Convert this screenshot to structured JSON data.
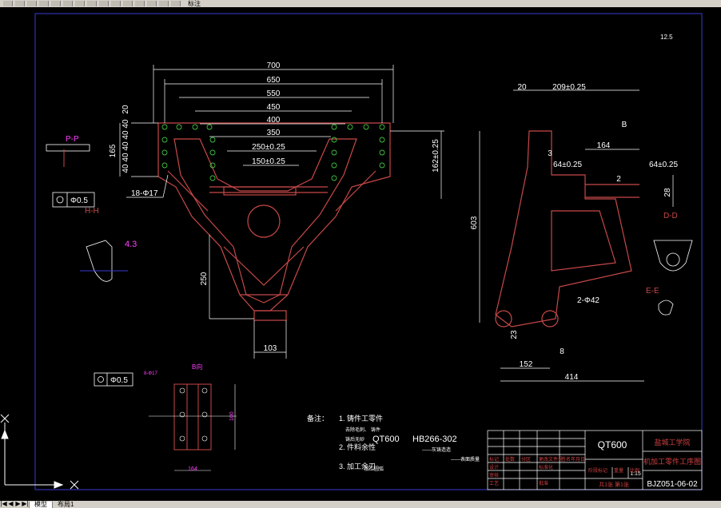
{
  "toolbar": {
    "trailing_label": "标注"
  },
  "tabs": [
    {
      "label": "模型"
    },
    {
      "label": "布局1"
    }
  ],
  "colors": {
    "frame": "#3a3ad8",
    "part": "#c84848",
    "dim": "#ffffff",
    "note": "#d04040",
    "symbol": "#ff40ff",
    "select": "#00ffff"
  },
  "drawing": {
    "roughness": "12.5",
    "dims_front": [
      "700",
      "650",
      "550",
      "450",
      "400",
      "350",
      "250±0.25",
      "150±0.25",
      "165",
      "162±0.25",
      "250",
      "103",
      "20",
      "40",
      "40",
      "40",
      "40",
      "40"
    ],
    "section_pp": "P-P",
    "section_hh": "H-H",
    "view_b": "B",
    "dims_side": [
      "20",
      "209±0.25",
      "164",
      "64±0.25",
      "64±0.25",
      "603",
      "2-Φ42",
      "152",
      "414",
      "28",
      "2",
      "23",
      "8",
      "3"
    ],
    "section_dd": "D-D",
    "section_ee": "E-E",
    "tol_1_value": "Φ0.5",
    "tol_1_note": "18-Φ17",
    "tol_2_value": "Φ0.5",
    "detail_dims": [
      "164",
      "100",
      "8-Φ17"
    ],
    "detail_label": "B向",
    "section_h_dim": "4.3",
    "notes_title": "备注：",
    "notes": [
      "1. 铸件工零件",
      "2. 件料余性",
      "3. 加工余刃"
    ],
    "notes_sub": [
      "去除毛刺、",
      "铸件",
      "铸后无砂",
      "加工圆弧"
    ],
    "material": "QT600",
    "standard": "HB266-302",
    "standard_note": "——灰铸造造",
    "standard_note2": "——表面质量",
    "title_block": {
      "material": "QT600",
      "school": "盐城工学院",
      "part_name": "机加工零件工序图",
      "drawing_no": "BJZ051-06-02",
      "scale": "1:15",
      "sheet": "共1张 第1张",
      "row_labels": [
        "标记",
        "处数",
        "分区",
        "更改文件号",
        "签名",
        "年月日",
        "设计",
        "标准化",
        "审核",
        "工艺",
        "批准",
        "阶段标记",
        "重量",
        "比例"
      ]
    }
  }
}
